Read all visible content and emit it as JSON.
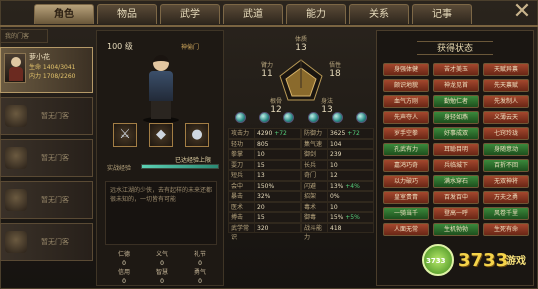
{
  "tabs": [
    "角色",
    "物品",
    "武学",
    "武道",
    "能力",
    "关系",
    "记事"
  ],
  "left": {
    "header": "我的门客",
    "active": {
      "name": "萝小花",
      "life": "生命 1404/3041",
      "inner": "内力 1708/2260"
    },
    "empty_label": "暂无门客"
  },
  "character": {
    "level": "100 级",
    "title": "神偷门",
    "exp_label": "实战经验",
    "exp_percent": 100,
    "exp_max": "已达经验上限",
    "description": "远水江湖的少侠，去有起样的未来还都很未知的，一切皆有可能",
    "equip_icons": [
      "sword-icon",
      "armor-icon",
      "coin-icon"
    ],
    "virtues": [
      {
        "k": "仁德",
        "v": "0"
      },
      {
        "k": "义气",
        "v": "0"
      },
      {
        "k": "礼节",
        "v": "0"
      },
      {
        "k": "信用",
        "v": "0"
      },
      {
        "k": "智慧",
        "v": "0"
      },
      {
        "k": "勇气",
        "v": "0"
      }
    ]
  },
  "attributes": {
    "体质": "13",
    "臂力": "11",
    "悟性": "18",
    "根骨": "12",
    "身法": "13"
  },
  "stats": [
    [
      {
        "k": "攻击力",
        "v": "4290",
        "plus": "+72"
      },
      {
        "k": "防御力",
        "v": "3625",
        "plus": "+72"
      }
    ],
    [
      {
        "k": "轻功",
        "v": "805",
        "plus": ""
      },
      {
        "k": "集气速度",
        "v": "104",
        "plus": ""
      }
    ],
    [
      {
        "k": "拳掌",
        "v": "10",
        "plus": ""
      },
      {
        "k": "御剑",
        "v": "239",
        "plus": ""
      }
    ],
    [
      {
        "k": "耍刀",
        "v": "15",
        "plus": ""
      },
      {
        "k": "长兵",
        "v": "10",
        "plus": ""
      }
    ],
    [
      {
        "k": "短兵",
        "v": "13",
        "plus": ""
      },
      {
        "k": "奇门",
        "v": "12",
        "plus": ""
      }
    ],
    [
      {
        "k": "会中",
        "v": "150%",
        "plus": ""
      },
      {
        "k": "闪避",
        "v": "13%",
        "plus": "+4%"
      }
    ],
    [
      {
        "k": "暴击",
        "v": "32%",
        "plus": ""
      },
      {
        "k": "招架",
        "v": "0%",
        "plus": ""
      }
    ],
    [
      {
        "k": "医术",
        "v": "20",
        "plus": ""
      },
      {
        "k": "毒术",
        "v": "10",
        "plus": ""
      }
    ],
    [
      {
        "k": "搏击",
        "v": "15",
        "plus": ""
      },
      {
        "k": "御毒",
        "v": "15%",
        "plus": "+5%"
      }
    ],
    [
      {
        "k": "武学常识",
        "v": "320",
        "plus": ""
      },
      {
        "k": "战斗能力",
        "v": "418",
        "plus": ""
      }
    ]
  ],
  "achievements": {
    "title": "获得状态",
    "items": [
      {
        "label": "身强体健",
        "color": "red"
      },
      {
        "label": "苦才美玉",
        "color": "red"
      },
      {
        "label": "天赋异禀",
        "color": "red"
      },
      {
        "label": "颇识地貌",
        "color": "red"
      },
      {
        "label": "神龙见首",
        "color": "red"
      },
      {
        "label": "先天禀赋",
        "color": "red"
      },
      {
        "label": "血气方刚",
        "color": "red"
      },
      {
        "label": "勤勉仁者",
        "color": "green"
      },
      {
        "label": "先发制人",
        "color": "red"
      },
      {
        "label": "先声夺人",
        "color": "red"
      },
      {
        "label": "身轻如燕",
        "color": "green"
      },
      {
        "label": "义薄云天",
        "color": "red"
      },
      {
        "label": "岁手空拳",
        "color": "red"
      },
      {
        "label": "好事成双",
        "color": "green"
      },
      {
        "label": "七窍玲珑",
        "color": "red"
      },
      {
        "label": "孔武有力",
        "color": "green"
      },
      {
        "label": "耳聪目明",
        "color": "red"
      },
      {
        "label": "身随意动",
        "color": "green"
      },
      {
        "label": "嘉鸿巧奇",
        "color": "red"
      },
      {
        "label": "兵临城下",
        "color": "red"
      },
      {
        "label": "百折不回",
        "color": "green"
      },
      {
        "label": "以力破巧",
        "color": "red"
      },
      {
        "label": "满水穿石",
        "color": "green"
      },
      {
        "label": "无双神将",
        "color": "red"
      },
      {
        "label": "皇室贵胄",
        "color": "red"
      },
      {
        "label": "百发百中",
        "color": "red"
      },
      {
        "label": "万夫之勇",
        "color": "red"
      },
      {
        "label": "一骑当千",
        "color": "green"
      },
      {
        "label": "登高一呼",
        "color": "red"
      },
      {
        "label": "风卷千里",
        "color": "green"
      },
      {
        "label": "人面无常",
        "color": "red"
      },
      {
        "label": "生机勃勃",
        "color": "green"
      },
      {
        "label": "生死有命",
        "color": "red"
      }
    ]
  },
  "watermark": {
    "logo": "3733",
    "brand": "3733",
    "suffix": "游戏"
  }
}
